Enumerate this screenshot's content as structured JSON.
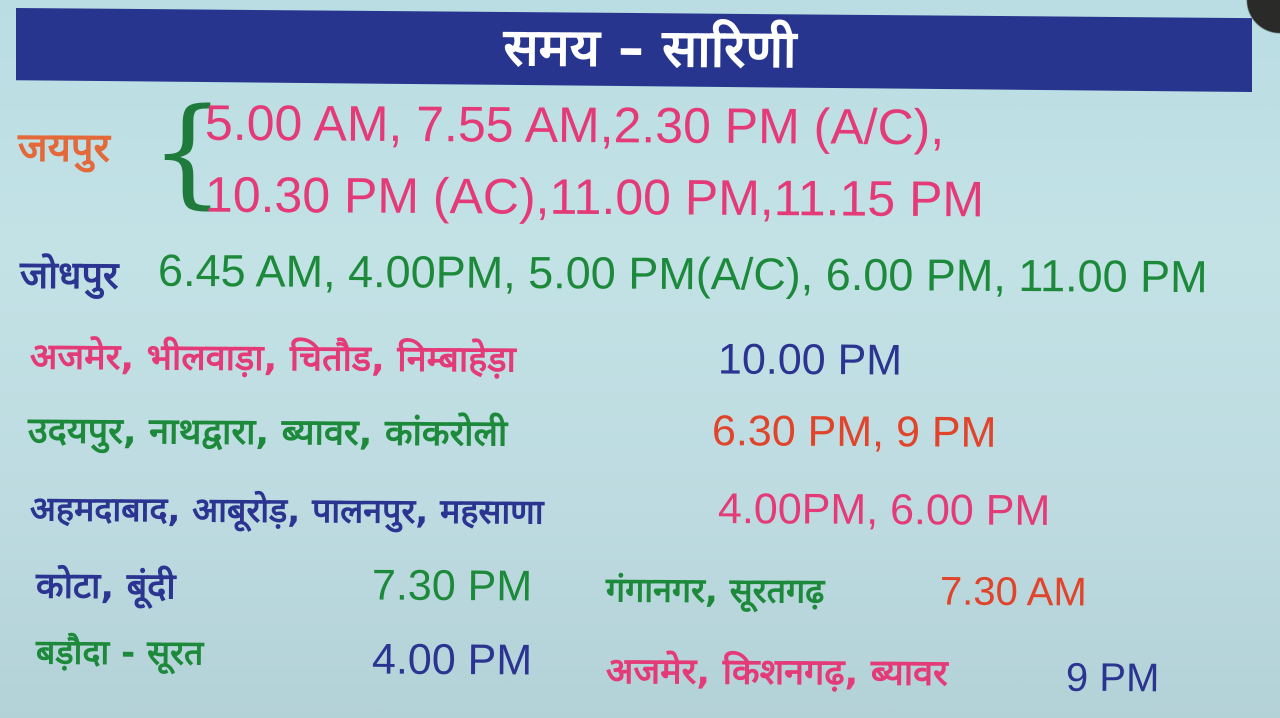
{
  "title": "समय – सारिणी",
  "colors": {
    "title_bar": "#28358f",
    "orange": "#e4693a",
    "pink": "#e43a78",
    "green": "#1c8a3a",
    "navy": "#2b3490",
    "red": "#e0442a"
  },
  "routes": {
    "jaipur": {
      "city": "जयपुर",
      "times_line1": "5.00 AM, 7.55 AM,2.30 PM (A/C),",
      "times_line2": "10.30 PM (AC),11.00 PM,11.15 PM"
    },
    "jodhpur": {
      "city": "जोधपुर",
      "times": "6.45 AM, 4.00PM, 5.00 PM(A/C), 6.00 PM, 11.00 PM"
    },
    "ajmer_route": {
      "city": "अजमेर, भीलवाड़ा, चितौड, निम्बाहेड़ा",
      "times": "10.00 PM"
    },
    "udaipur_route": {
      "city": "उदयपुर, नाथद्वारा, ब्यावर, कांकरोली",
      "times": "6.30 PM, 9 PM"
    },
    "ahmedabad_route": {
      "city": "अहमदाबाद, आबूरोड़, पालनपुर, महसाणा",
      "times": "4.00PM, 6.00 PM"
    },
    "kota_route": {
      "city": "कोटा, बूंदी",
      "times": "7.30 PM"
    },
    "ganganagar_route": {
      "city": "गंगानगर, सूरतगढ़",
      "times": "7.30 AM"
    },
    "baroda_route": {
      "city": "बड़ौदा - सूरत",
      "times": "4.00 PM"
    },
    "kishangarh_route": {
      "city": "अजमेर, किशनगढ़, ब्यावर",
      "times": "9 PM"
    }
  }
}
